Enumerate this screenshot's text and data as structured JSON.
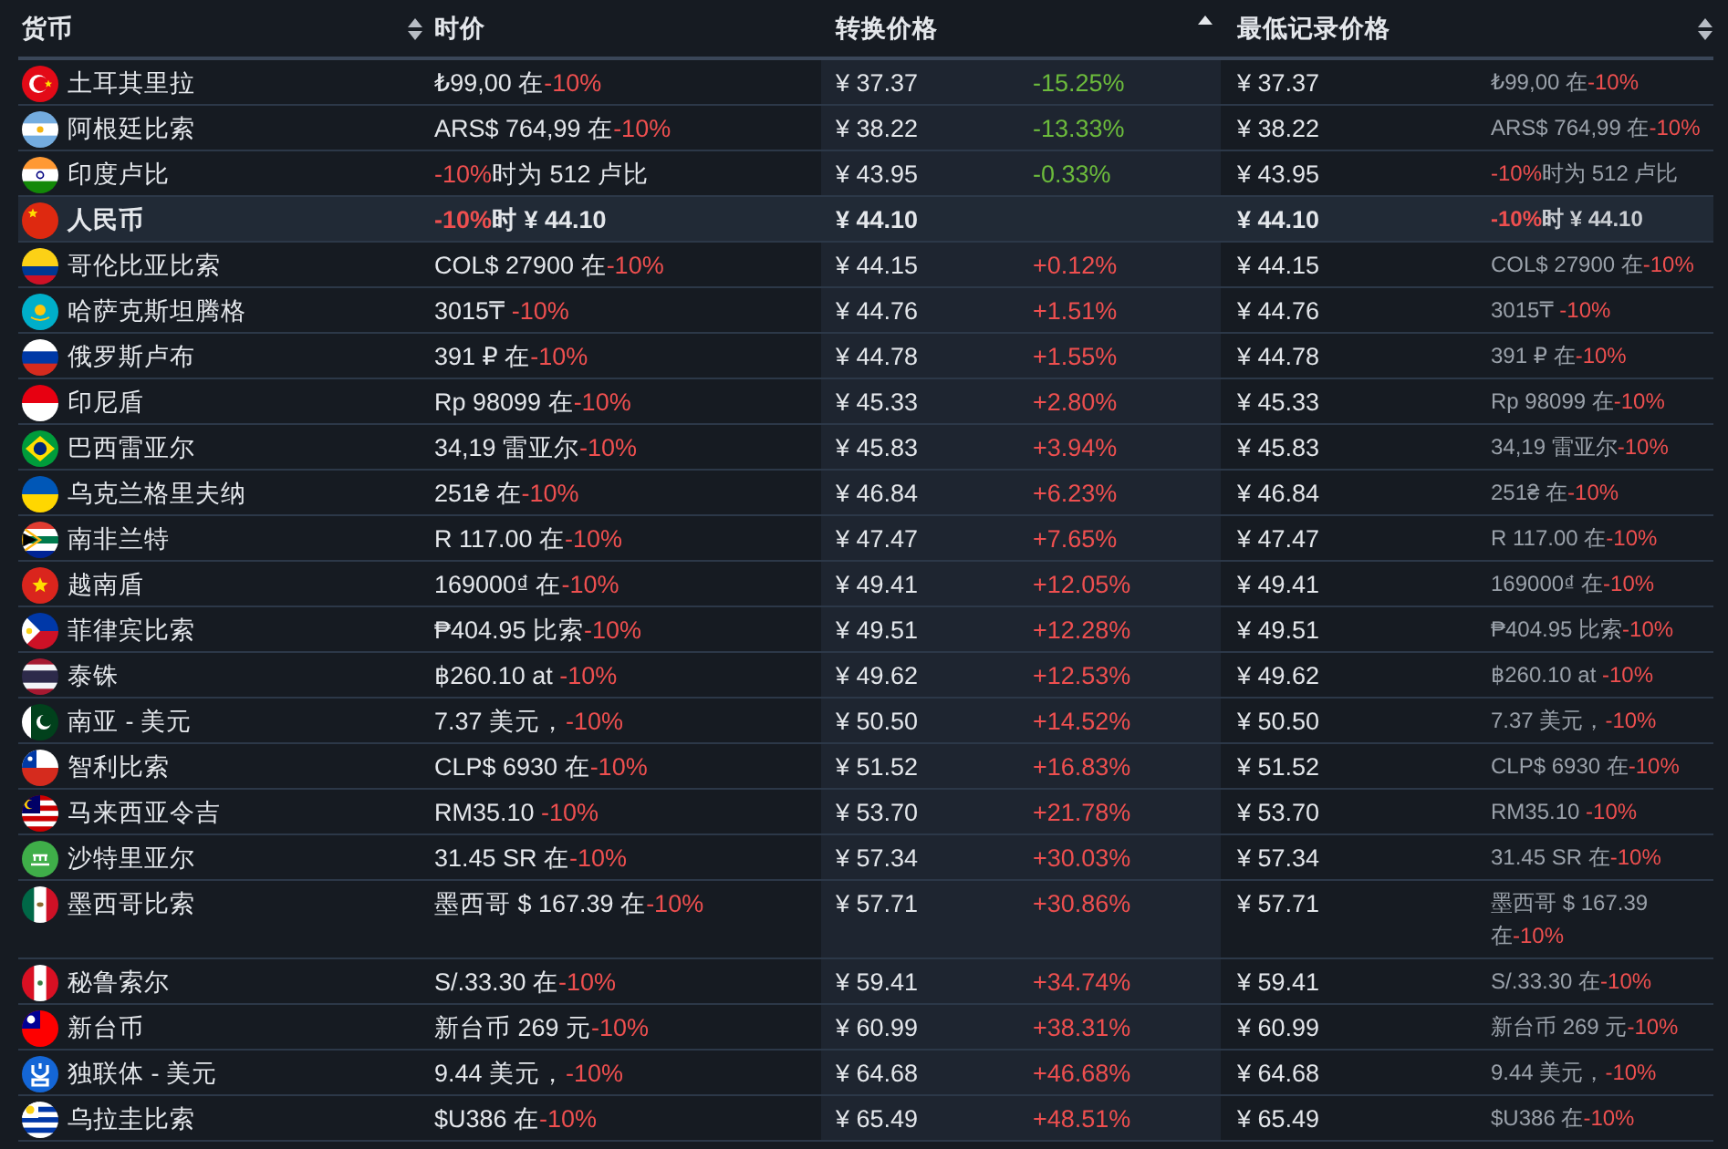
{
  "table": {
    "columns": [
      {
        "label": "货币",
        "sortable": true,
        "sorted": false
      },
      {
        "label": "时价"
      },
      {
        "label": "转换价格",
        "sorted": true
      },
      {
        "label": "最低记录价格",
        "sortable": true,
        "sorted": false
      }
    ],
    "rows": [
      {
        "currency": "土耳其里拉",
        "price": {
          "before": "₺99,00 在",
          "discount": "-10%"
        },
        "converted": "¥ 37.37",
        "change": "-15.25%",
        "color": "#6cbb3c",
        "lowest": "¥ 37.37",
        "lowest_note": {
          "before": "₺99,00 在",
          "discount": "-10%"
        },
        "selected": false
      },
      {
        "currency": "阿根廷比索",
        "price": {
          "before": "ARS$ 764,99 在",
          "discount": "-10%"
        },
        "converted": "¥ 38.22",
        "change": "-13.33%",
        "color": "#6cbb3c",
        "lowest": "¥ 38.22",
        "lowest_note": {
          "before": "ARS$ 764,99 在",
          "discount": "-10%"
        },
        "selected": false
      },
      {
        "currency": "印度卢比",
        "price": {
          "discount": "-10%",
          "after": "时为 512 卢比"
        },
        "converted": "¥ 43.95",
        "change": "-0.33%",
        "color": "#6cbb3c",
        "lowest": "¥ 43.95",
        "lowest_note": {
          "discount": "-10%",
          "after": "时为 512 卢比"
        },
        "selected": false
      },
      {
        "currency": "人民币",
        "price": {
          "discount": "-10%",
          "after": "时 ¥ 44.10"
        },
        "converted": "¥ 44.10",
        "lowest": "¥ 44.10",
        "lowest_note": {
          "discount": "-10%",
          "after": "时 ¥ 44.10"
        },
        "selected": true
      },
      {
        "currency": "哥伦比亚比索",
        "price": {
          "before": "COL$ 27900 在",
          "discount": "-10%"
        },
        "converted": "¥ 44.15",
        "change": "+0.12%",
        "color": "#ee4f4f",
        "lowest": "¥ 44.15",
        "lowest_note": {
          "before": "COL$ 27900 在",
          "discount": "-10%"
        },
        "selected": false
      },
      {
        "currency": "哈萨克斯坦腾格",
        "price": {
          "before": "3015₸ ",
          "discount": "-10%"
        },
        "converted": "¥ 44.76",
        "change": "+1.51%",
        "color": "#ee4f4f",
        "lowest": "¥ 44.76",
        "lowest_note": {
          "before": "3015₸ ",
          "discount": "-10%"
        },
        "selected": false
      },
      {
        "currency": "俄罗斯卢布",
        "price": {
          "before": "391 ₽ 在",
          "discount": "-10%"
        },
        "converted": "¥ 44.78",
        "change": "+1.55%",
        "color": "#ee4f4f",
        "lowest": "¥ 44.78",
        "lowest_note": {
          "before": "391 ₽ 在",
          "discount": "-10%"
        },
        "selected": false
      },
      {
        "currency": "印尼盾",
        "price": {
          "before": "Rp 98099 在",
          "discount": "-10%"
        },
        "converted": "¥ 45.33",
        "change": "+2.80%",
        "color": "#ee4f4f",
        "lowest": "¥ 45.33",
        "lowest_note": {
          "before": "Rp 98099 在",
          "discount": "-10%"
        },
        "selected": false
      },
      {
        "currency": "巴西雷亚尔",
        "price": {
          "before": "34,19 雷亚尔",
          "discount": "-10%"
        },
        "converted": "¥ 45.83",
        "change": "+3.94%",
        "color": "#ee4f4f",
        "lowest": "¥ 45.83",
        "lowest_note": {
          "before": "34,19 雷亚尔",
          "discount": "-10%"
        },
        "selected": false
      },
      {
        "currency": "乌克兰格里夫纳",
        "price": {
          "before": "251₴ 在",
          "discount": "-10%"
        },
        "converted": "¥ 46.84",
        "change": "+6.23%",
        "color": "#ee4f4f",
        "lowest": "¥ 46.84",
        "lowest_note": {
          "before": "251₴ 在",
          "discount": "-10%"
        },
        "selected": false
      },
      {
        "currency": "南非兰特",
        "price": {
          "before": "R 117.00 在",
          "discount": "-10%"
        },
        "converted": "¥ 47.47",
        "change": "+7.65%",
        "color": "#ee4f4f",
        "lowest": "¥ 47.47",
        "lowest_note": {
          "before": "R 117.00 在",
          "discount": "-10%"
        },
        "selected": false
      },
      {
        "currency": "越南盾",
        "price": {
          "before": "169000₫ 在",
          "discount": "-10%"
        },
        "converted": "¥ 49.41",
        "change": "+12.05%",
        "color": "#ee4f4f",
        "lowest": "¥ 49.41",
        "lowest_note": {
          "before": "169000₫ 在",
          "discount": "-10%"
        },
        "selected": false
      },
      {
        "currency": "菲律宾比索",
        "price": {
          "before": "₱404.95 比索",
          "discount": "-10%"
        },
        "converted": "¥ 49.51",
        "change": "+12.28%",
        "color": "#ee4f4f",
        "lowest": "¥ 49.51",
        "lowest_note": {
          "before": "₱404.95 比索",
          "discount": "-10%"
        },
        "selected": false
      },
      {
        "currency": "泰铢",
        "price": {
          "before": "฿260.10 at ",
          "discount": "-10%"
        },
        "converted": "¥ 49.62",
        "change": "+12.53%",
        "color": "#ee4f4f",
        "lowest": "¥ 49.62",
        "lowest_note": {
          "before": "฿260.10 at ",
          "discount": "-10%"
        },
        "selected": false
      },
      {
        "currency": "南亚 - 美元",
        "price": {
          "before": "7.37 美元，",
          "discount": "-10%"
        },
        "converted": "¥ 50.50",
        "change": "+14.52%",
        "color": "#ee4f4f",
        "lowest": "¥ 50.50",
        "lowest_note": {
          "before": "7.37 美元，",
          "discount": "-10%"
        },
        "selected": false
      },
      {
        "currency": "智利比索",
        "price": {
          "before": "CLP$ 6930 在",
          "discount": "-10%"
        },
        "converted": "¥ 51.52",
        "change": "+16.83%",
        "color": "#ee4f4f",
        "lowest": "¥ 51.52",
        "lowest_note": {
          "before": "CLP$ 6930 在",
          "discount": "-10%"
        },
        "selected": false
      },
      {
        "currency": "马来西亚令吉",
        "price": {
          "before": "RM35.10 ",
          "discount": "-10%"
        },
        "converted": "¥ 53.70",
        "change": "+21.78%",
        "color": "#ee4f4f",
        "lowest": "¥ 53.70",
        "lowest_note": {
          "before": "RM35.10 ",
          "discount": "-10%"
        },
        "selected": false
      },
      {
        "currency": "沙特里亚尔",
        "price": {
          "before": "31.45 SR 在",
          "discount": "-10%"
        },
        "converted": "¥ 57.34",
        "change": "+30.03%",
        "color": "#ee4f4f",
        "lowest": "¥ 57.34",
        "lowest_note": {
          "before": "31.45 SR 在",
          "discount": "-10%"
        },
        "selected": false
      },
      {
        "currency": "墨西哥比索",
        "price": {
          "before": "墨西哥 $ 167.39 在",
          "discount": "-10%"
        },
        "converted": "¥ 57.71",
        "change": "+30.86%",
        "color": "#ee4f4f",
        "lowest": "¥ 57.71",
        "lowest_note": {
          "before": "墨西哥 $ 167.39 在",
          "discount": "-10%"
        },
        "selected": false
      },
      {
        "currency": "秘鲁索尔",
        "price": {
          "before": "S/.33.30 在",
          "discount": "-10%"
        },
        "converted": "¥ 59.41",
        "change": "+34.74%",
        "color": "#ee4f4f",
        "lowest": "¥ 59.41",
        "lowest_note": {
          "before": "S/.33.30 在",
          "discount": "-10%"
        },
        "selected": false
      },
      {
        "currency": "新台币",
        "price": {
          "before": "新台币 269 元",
          "discount": "-10%"
        },
        "converted": "¥ 60.99",
        "change": "+38.31%",
        "color": "#ee4f4f",
        "lowest": "¥ 60.99",
        "lowest_note": {
          "before": "新台币 269 元",
          "discount": "-10%"
        },
        "selected": false
      },
      {
        "currency": "独联体 - 美元",
        "price": {
          "before": "9.44 美元，",
          "discount": "-10%"
        },
        "converted": "¥ 64.68",
        "change": "+46.68%",
        "color": "#ee4f4f",
        "lowest": "¥ 64.68",
        "lowest_note": {
          "before": "9.44 美元，",
          "discount": "-10%"
        },
        "selected": false
      },
      {
        "currency": "乌拉圭比索",
        "price": {
          "before": "$U386 在",
          "discount": "-10%"
        },
        "converted": "¥ 65.49",
        "change": "+48.51%",
        "color": "#ee4f4f",
        "lowest": "¥ 65.49",
        "lowest_note": {
          "before": "$U386 在",
          "discount": "-10%"
        },
        "selected": false
      }
    ]
  }
}
